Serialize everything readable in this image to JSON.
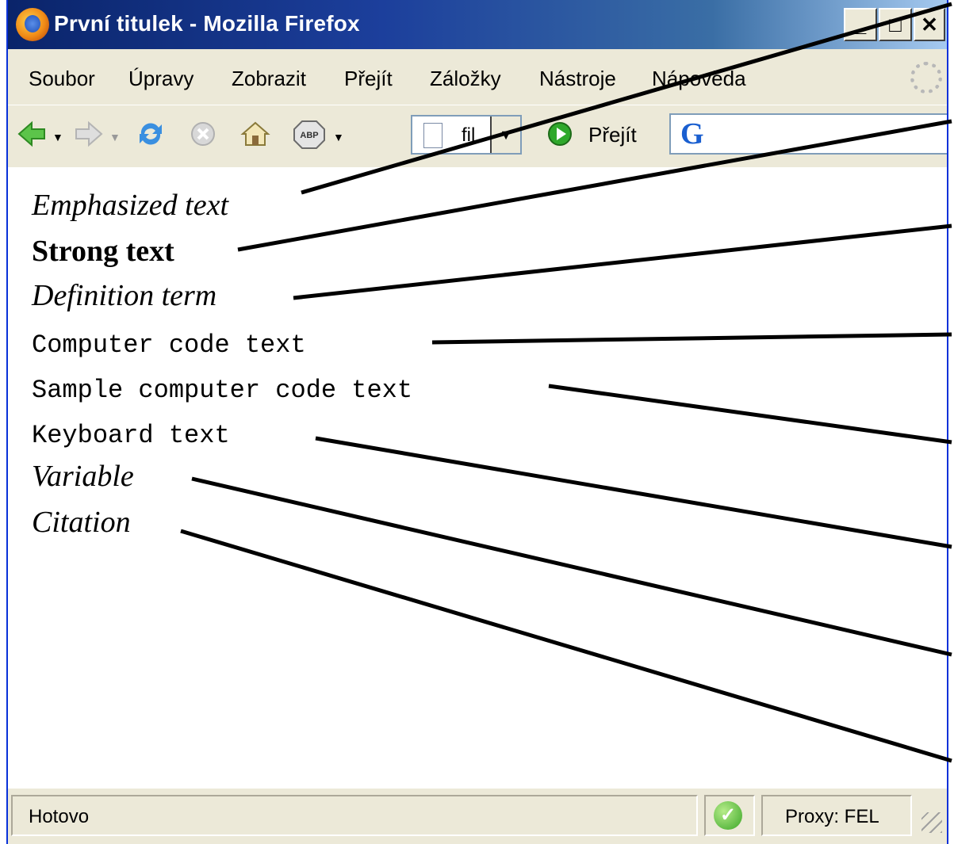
{
  "window": {
    "title": "První titulek - Mozilla Firefox",
    "controls": {
      "minimize": "_",
      "maximize": "□",
      "close": "✕"
    }
  },
  "menubar": {
    "items": [
      {
        "label": "Soubor"
      },
      {
        "label": "Úpravy"
      },
      {
        "label": "Zobrazit"
      },
      {
        "label": "Přejít"
      },
      {
        "label": "Záložky"
      },
      {
        "label": "Nástroje"
      },
      {
        "label": "Nápověda"
      }
    ]
  },
  "toolbar": {
    "back_icon": "back-arrow-icon",
    "forward_icon": "forward-arrow-icon",
    "reload_icon": "reload-icon",
    "stop_icon": "stop-icon",
    "home_icon": "home-icon",
    "abp_label": "ABP",
    "url_value": "fil",
    "go_label": "Přejít",
    "search_engine_label": "G"
  },
  "content": {
    "lines": [
      {
        "text": "Emphasized text",
        "style": "em"
      },
      {
        "text": "Strong text",
        "style": "strong"
      },
      {
        "text": "Definition term",
        "style": "dfn"
      },
      {
        "text": "Computer code text",
        "style": "code"
      },
      {
        "text": "Sample computer code text",
        "style": "samp"
      },
      {
        "text": "Keyboard text",
        "style": "kbd"
      },
      {
        "text": "Variable",
        "style": "var"
      },
      {
        "text": "Citation",
        "style": "cite"
      }
    ]
  },
  "statusbar": {
    "status_text": "Hotovo",
    "proxy_text": "Proxy: FEL"
  },
  "colors": {
    "titlebar_start": "#0a246a",
    "titlebar_end": "#a6caf0",
    "chrome_bg": "#ece9d8",
    "go_green": "#2fa82b"
  }
}
